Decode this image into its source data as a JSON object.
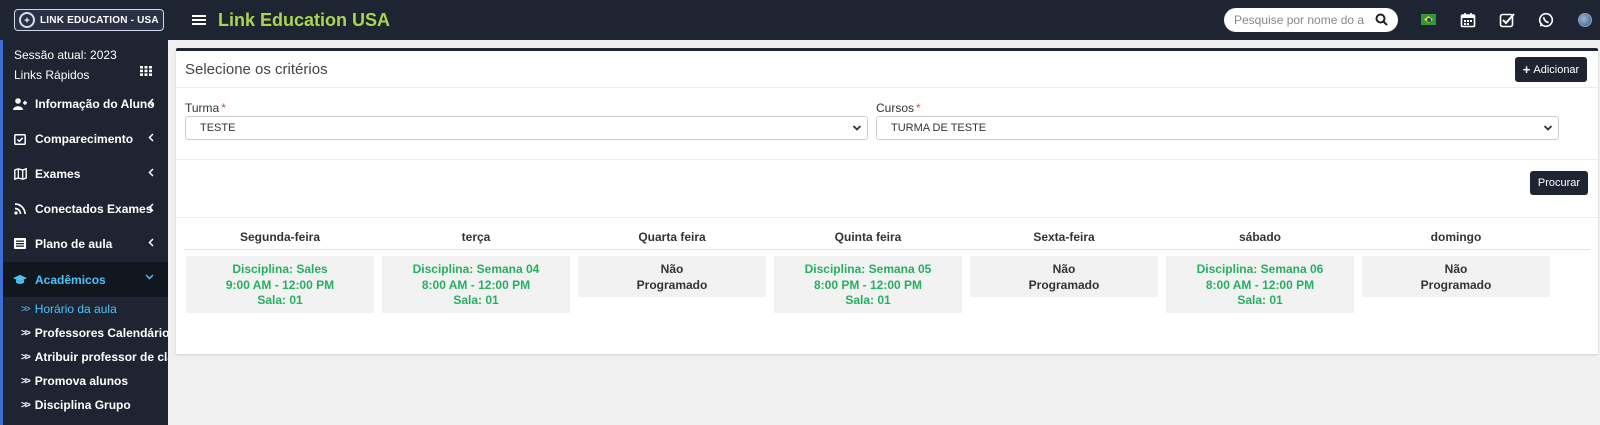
{
  "header": {
    "logo_text": "LINK EDUCATION - USA",
    "app_title": "Link Education USA",
    "search_placeholder": "Pesquise por nome do al"
  },
  "sidebar": {
    "session": "Sessão atual: 2023",
    "quick_links": "Links Rápidos",
    "items": [
      {
        "label": "Informação do Aluno",
        "icon": "user-plus-icon"
      },
      {
        "label": "Comparecimento",
        "icon": "calendar-check-icon"
      },
      {
        "label": "Exames",
        "icon": "map-icon"
      },
      {
        "label": "Conectados Exames",
        "icon": "rss-icon"
      },
      {
        "label": "Plano de aula",
        "icon": "list-icon"
      },
      {
        "label": "Acadêmicos",
        "icon": "graduation-cap-icon"
      }
    ],
    "subitems": [
      "Horário da aula",
      "Professores Calendário",
      "Atribuir professor de classe",
      "Promova alunos",
      "Disciplina Grupo"
    ]
  },
  "main": {
    "title": "Selecione os critérios",
    "add_label": "Adicionar",
    "turma_label": "Turma",
    "turma_value": "TESTE",
    "cursos_label": "Cursos",
    "cursos_value": "TURMA DE TESTE",
    "required_mark": "*",
    "search_label": "Procurar"
  },
  "schedule": {
    "days": [
      {
        "day": "Segunda-feira",
        "lines": [
          "Disciplina: Sales",
          "9:00 AM - 12:00 PM",
          "Sala: 01"
        ],
        "scheduled": true
      },
      {
        "day": "terça",
        "lines": [
          "Disciplina: Semana 04",
          "8:00 AM - 12:00 PM",
          "Sala: 01"
        ],
        "scheduled": true
      },
      {
        "day": "Quarta feira",
        "lines": [
          "Não",
          "Programado"
        ],
        "scheduled": false
      },
      {
        "day": "Quinta feira",
        "lines": [
          "Disciplina: Semana 05",
          "8:00 PM - 12:00 PM",
          "Sala: 01"
        ],
        "scheduled": true
      },
      {
        "day": "Sexta-feira",
        "lines": [
          "Não",
          "Programado"
        ],
        "scheduled": false
      },
      {
        "day": "sábado",
        "lines": [
          "Disciplina: Semana 06",
          "8:00 AM - 12:00 PM",
          "Sala: 01"
        ],
        "scheduled": true
      },
      {
        "day": "domingo",
        "lines": [
          "Não",
          "Programado"
        ],
        "scheduled": false
      }
    ]
  },
  "colors": {
    "dark": "#1f2433",
    "accent_green": "#a9d651",
    "schedule_green": "#27ae60",
    "active_blue": "#4fc3f7"
  }
}
